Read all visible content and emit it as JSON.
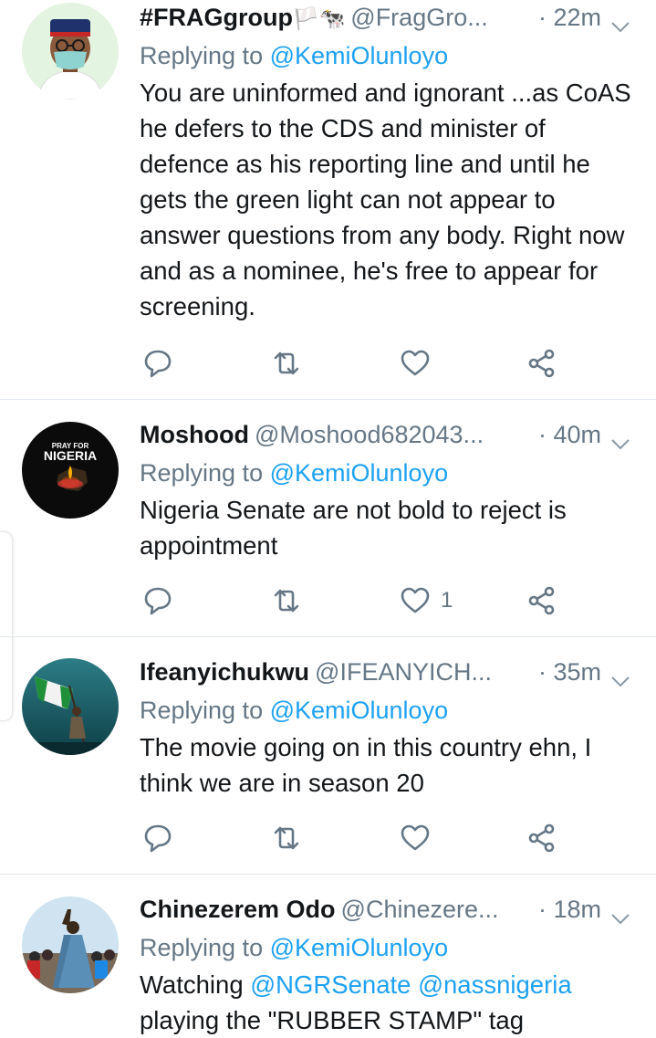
{
  "tweets": [
    {
      "name": "#FRAGgroup",
      "name_emoji": "🏳️🐄",
      "handle": "@FragGro...",
      "time": "· 22m",
      "replying_prefix": "Replying to ",
      "replying_to": "@KemiOlunloyo",
      "text": "You are uninformed and ignorant  ...as CoAS he defers to the CDS and minister of defence as his reporting line and until he gets the green light can not appear to answer questions from any body. Right now and as a nominee, he's free to appear for screening.",
      "likes": ""
    },
    {
      "name": "Moshood",
      "handle": "@Moshood682043...",
      "time": "· 40m",
      "replying_prefix": "Replying to ",
      "replying_to": "@KemiOlunloyo",
      "text": "Nigeria Senate are not bold to reject is appointment",
      "likes": "1",
      "avatar_text_top": "PRAY FOR",
      "avatar_text_main": "NIGERIA"
    },
    {
      "name": "Ifeanyichukwu",
      "handle": "@IFEANYICH...",
      "time": "· 35m",
      "replying_prefix": "Replying to ",
      "replying_to": "@KemiOlunloyo",
      "text": "The movie going on in this country ehn, I think we are in season 20",
      "likes": ""
    },
    {
      "name": "Chinezerem Odo",
      "handle": "@Chinezere...",
      "time": "· 18m",
      "replying_prefix": "Replying to ",
      "replying_to": "@KemiOlunloyo",
      "text_before": "Watching ",
      "text_mention1": "@NGRSenate",
      "text_space": " ",
      "text_mention2": "@nassnigeria",
      "text_after": "playing the \"RUBBER STAMP\" tag",
      "likes": ""
    }
  ],
  "icons": [
    "reply-icon",
    "retweet-icon",
    "like-icon",
    "share-icon",
    "chevron-down-icon"
  ],
  "colors": {
    "link": "#1da1f2",
    "muted": "#657786",
    "text": "#14171a"
  }
}
